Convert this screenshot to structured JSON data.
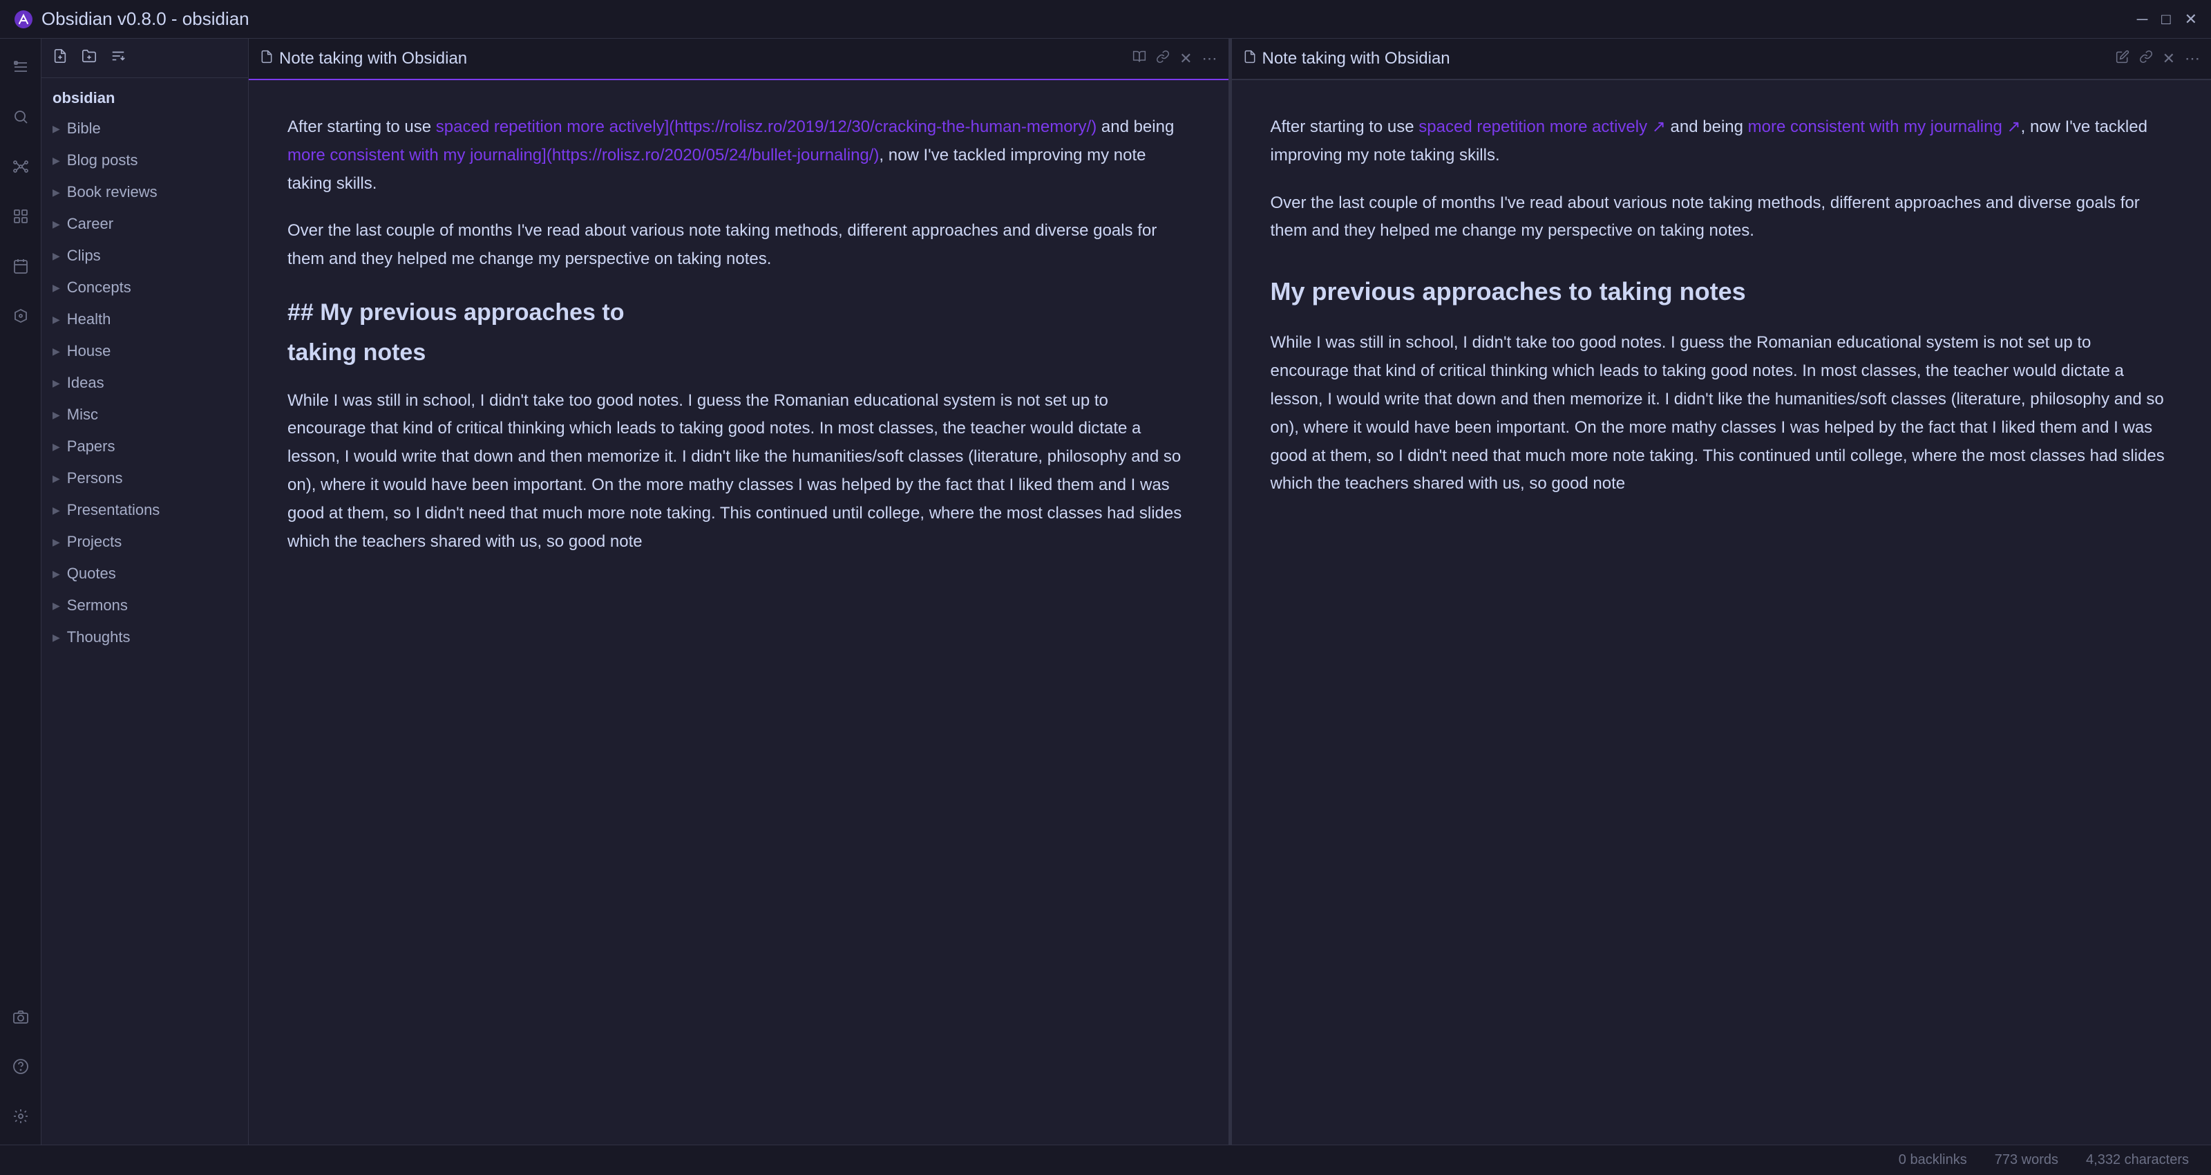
{
  "titlebar": {
    "title": "Obsidian v0.8.0 - obsidian",
    "minimize": "─",
    "maximize": "□",
    "close": "✕"
  },
  "sidebar": {
    "heading": "obsidian",
    "items": [
      {
        "label": "Bible",
        "id": "bible"
      },
      {
        "label": "Blog posts",
        "id": "blog-posts"
      },
      {
        "label": "Book reviews",
        "id": "book-reviews"
      },
      {
        "label": "Career",
        "id": "career"
      },
      {
        "label": "Clips",
        "id": "clips"
      },
      {
        "label": "Concepts",
        "id": "concepts"
      },
      {
        "label": "Health",
        "id": "health"
      },
      {
        "label": "House",
        "id": "house"
      },
      {
        "label": "Ideas",
        "id": "ideas"
      },
      {
        "label": "Misc",
        "id": "misc"
      },
      {
        "label": "Papers",
        "id": "papers"
      },
      {
        "label": "Persons",
        "id": "persons"
      },
      {
        "label": "Presentations",
        "id": "presentations"
      },
      {
        "label": "Projects",
        "id": "projects"
      },
      {
        "label": "Quotes",
        "id": "quotes"
      },
      {
        "label": "Sermons",
        "id": "sermons"
      },
      {
        "label": "Thoughts",
        "id": "thoughts"
      }
    ]
  },
  "left_pane": {
    "tab_title": "Note taking with Obsidian",
    "content": {
      "intro": "After starting to use ",
      "link1_text": "spaced repetition more actively](https://rolisz.ro/2019/12/30/cracking-the-human-memory/)",
      "and_being": " and being ",
      "link2_text": "more consistent with my journaling](https://rolisz.ro/2020/05/24/bullet-journaling/)",
      "after_links": ", now I've tackled improving my note taking skills.",
      "para2": "Over the last couple of months I've read about various note taking methods, different approaches and diverse goals for them and they helped me change my perspective on taking notes.",
      "heading": "## My previous approaches to taking notes",
      "para3": "While I was still in school, I didn't take too good notes. I guess the Romanian educational system is not set up to encourage that kind of critical thinking which leads to taking good notes. In most classes, the teacher would dictate a lesson, I would write that down and then memorize it. I didn't like the humanities/soft classes (literature, philosophy and so on), where it would have been important. On the more mathy classes I was helped by the fact that I liked them and I was good at them, so I didn't need that much more note taking. This continued until college, where the most classes had slides which the teachers shared with us, so good note"
    }
  },
  "right_pane": {
    "tab_title": "Note taking with Obsidian",
    "content": {
      "intro": "After starting to use ",
      "link1_text": "spaced repetition more actively",
      "and_being": " and being ",
      "link2_text": "more consistent with my journaling",
      "after_links": ", now I've tackled improving my note taking skills.",
      "para2": "Over the last couple of months I've read about various note taking methods, different approaches and diverse goals for them and they helped me change my perspective on taking notes.",
      "heading": "My previous approaches to taking notes",
      "para3": "While I was still in school, I didn't take too good notes. I guess the Romanian educational system is not set up to encourage that kind of critical thinking which leads to taking good notes. In most classes, the teacher would dictate a lesson, I would write that down and then memorize it. I didn't like the humanities/soft classes (literature, philosophy and so on), where it would have been important. On the more mathy classes I was helped by the fact that I liked them and I was good at them, so I didn't need that much more note taking. This continued until college, where the most classes had slides which the teachers shared with us, so good note"
    }
  },
  "statusbar": {
    "backlinks": "0 backlinks",
    "words": "773 words",
    "characters": "4,332 characters"
  },
  "activity": {
    "icons": [
      "folder",
      "search",
      "graph",
      "grid",
      "calendar",
      "tag",
      "camera",
      "help",
      "settings"
    ]
  }
}
